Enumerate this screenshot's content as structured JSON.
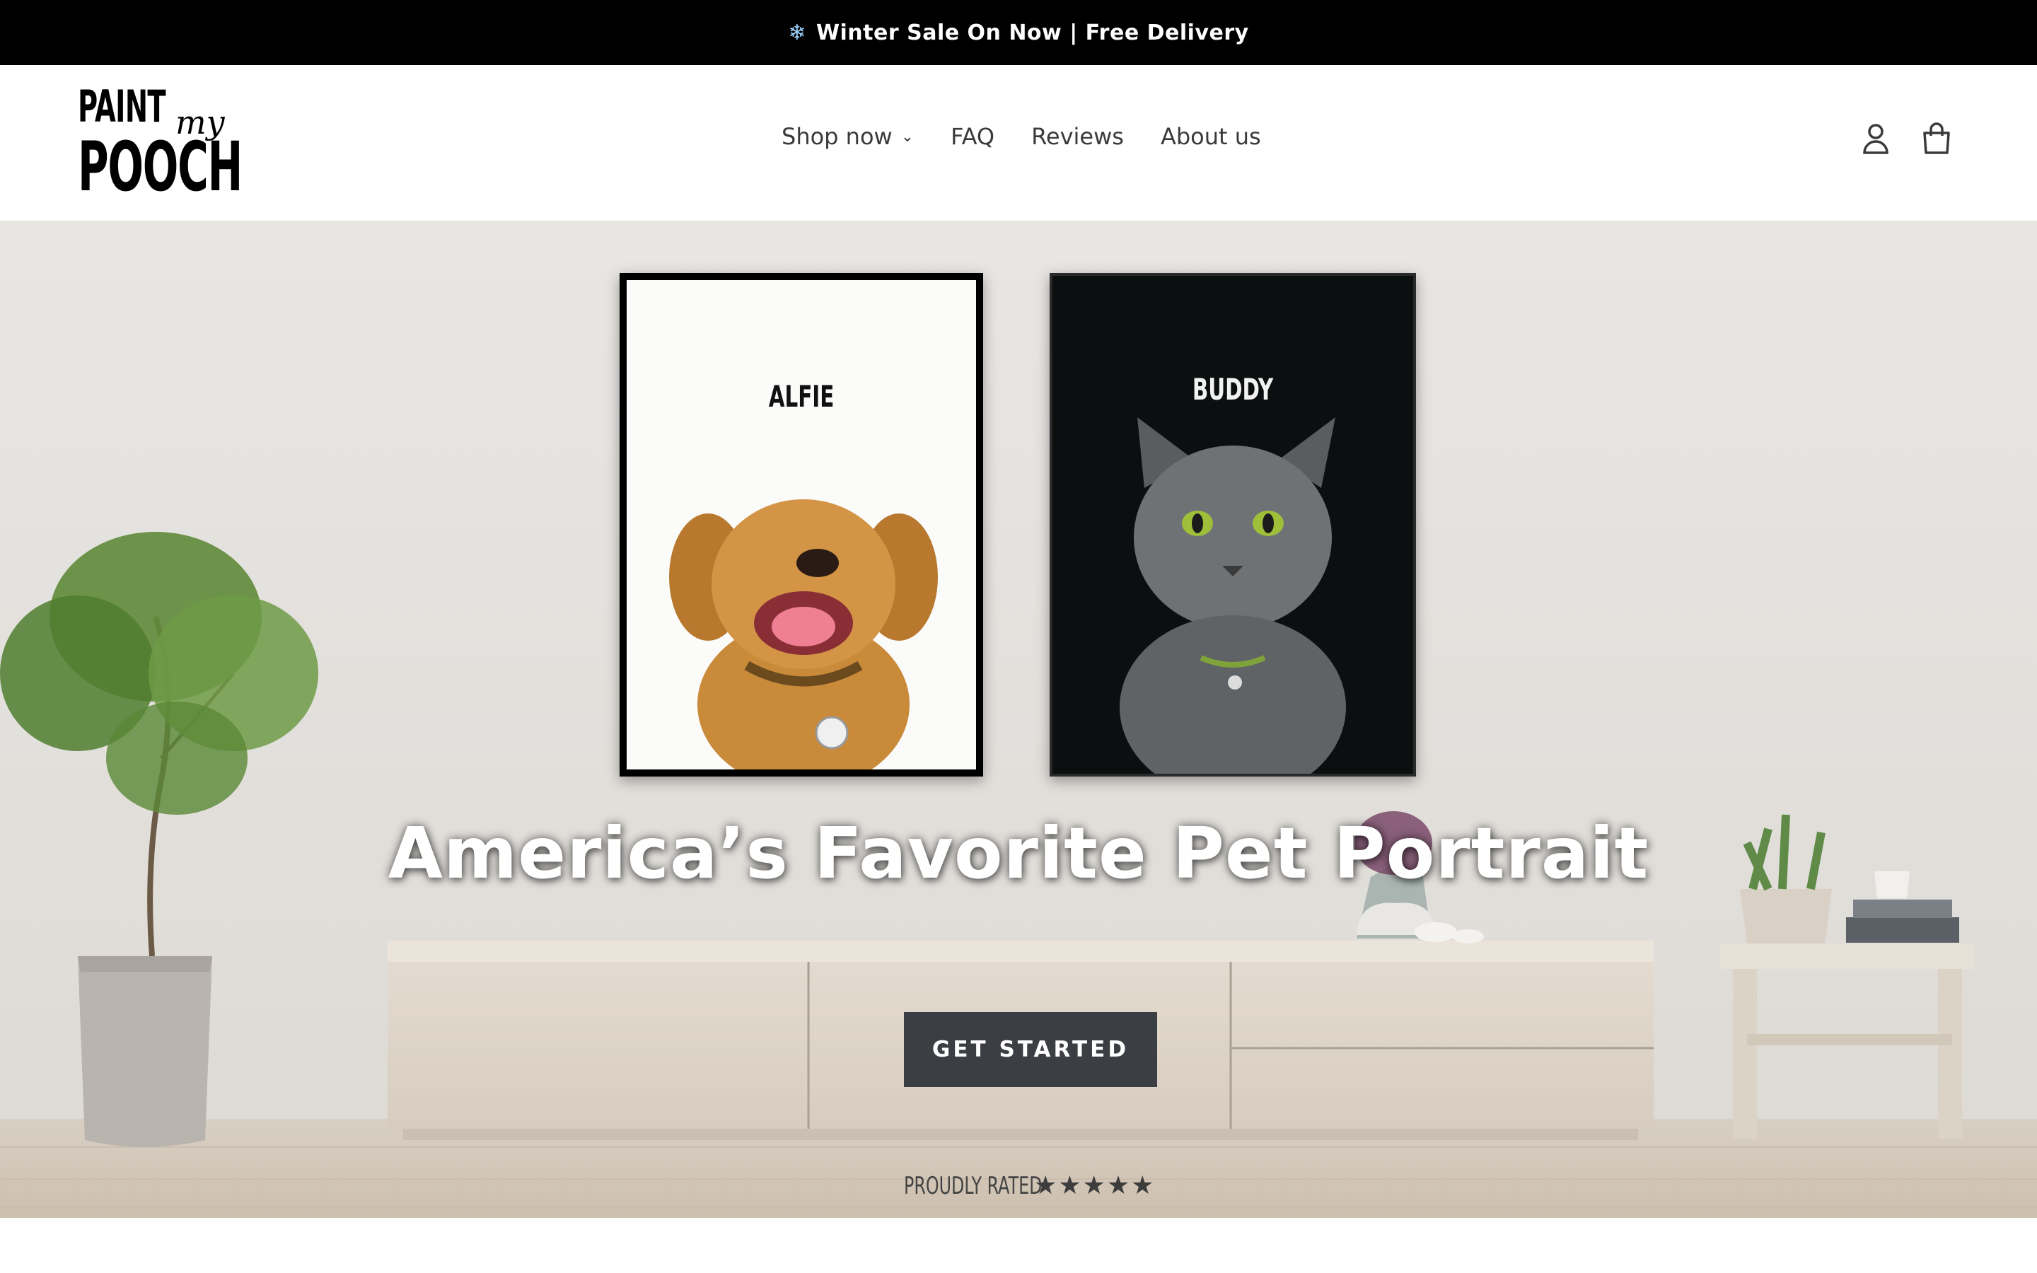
{
  "announcement": {
    "icon": "snowflake-icon",
    "text": "Winter Sale On Now | Free Delivery"
  },
  "logo": {
    "line1": "PAINT",
    "script": "my",
    "line2": "POOCH"
  },
  "nav": {
    "items": [
      {
        "label": "Shop now",
        "has_dropdown": true
      },
      {
        "label": "FAQ"
      },
      {
        "label": "Reviews"
      },
      {
        "label": "About us"
      }
    ]
  },
  "header_icons": [
    "account-icon",
    "cart-icon"
  ],
  "hero": {
    "portraits": [
      {
        "name": "ALFIE",
        "background": "white"
      },
      {
        "name": "BUDDY",
        "background": "black"
      }
    ],
    "headline": "America’s Favorite Pet Portrait",
    "cta_label": "GET STARTED",
    "rated_label": "PROUDLY RATED",
    "rating_stars": "★★★★★",
    "rating_count": 5
  },
  "colors": {
    "announcement_bg": "#000000",
    "cta_bg": "#3b3e42",
    "nav_text": "#3a3a3a"
  }
}
